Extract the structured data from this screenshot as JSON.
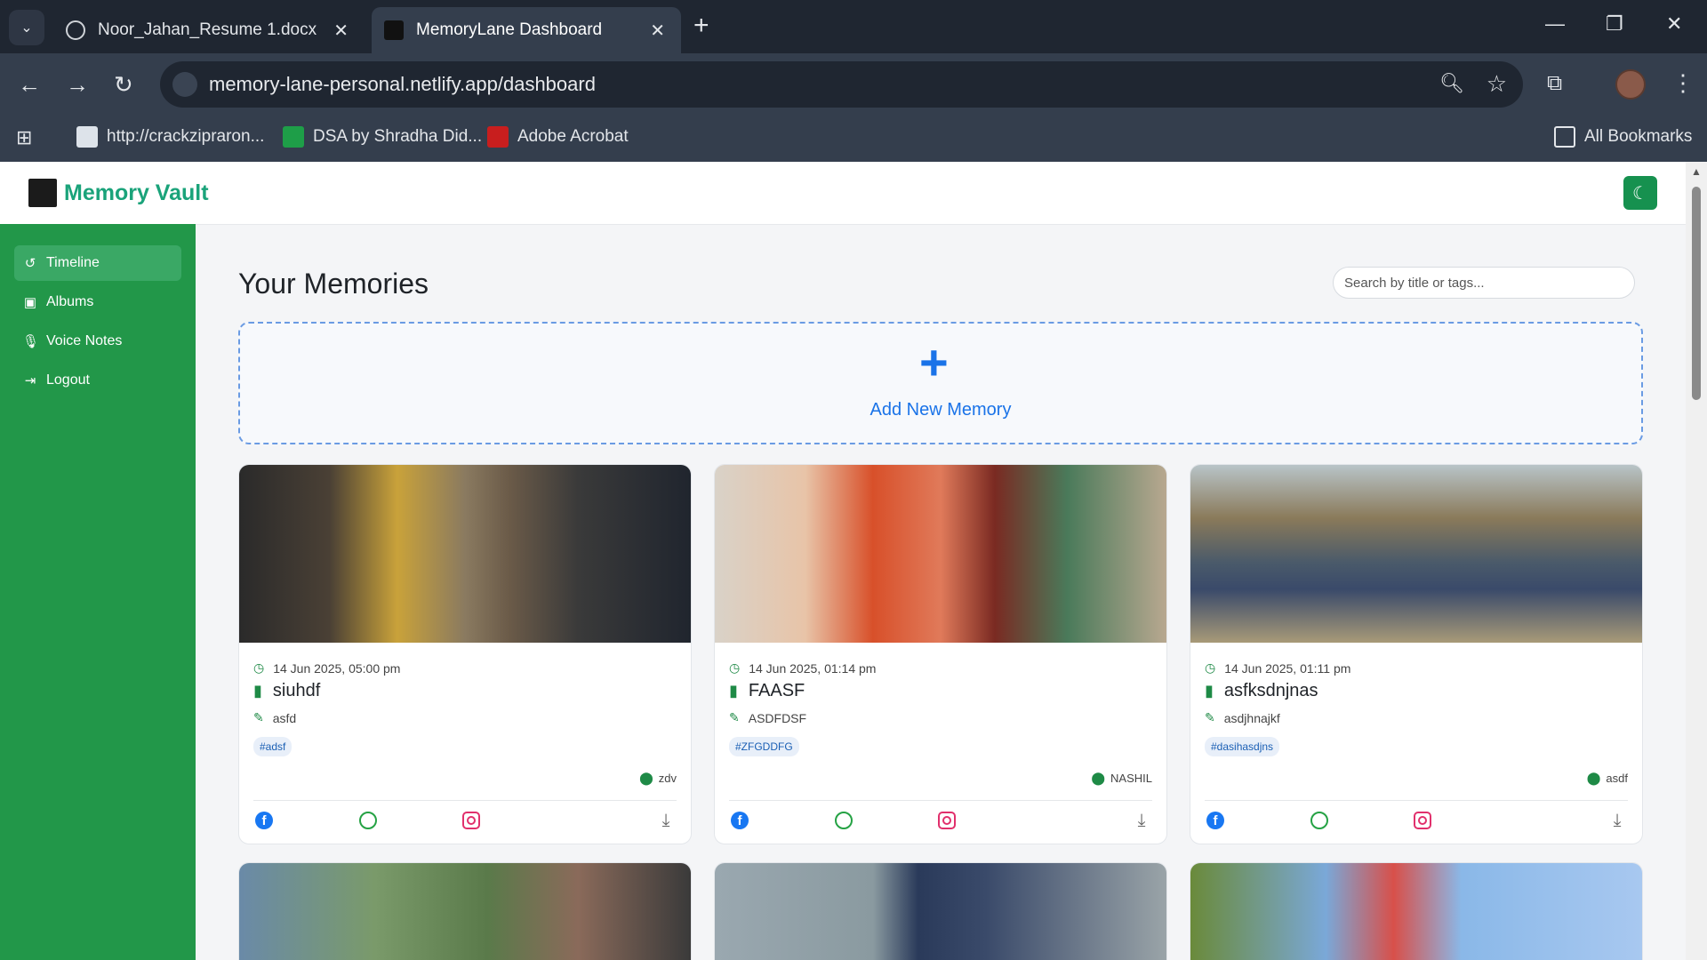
{
  "browser": {
    "tabs": [
      {
        "title": "Noor_Jahan_Resume 1.docx",
        "active": false
      },
      {
        "title": "MemoryLane Dashboard",
        "active": true
      }
    ],
    "url": "memory-lane-personal.netlify.app/dashboard",
    "bookmarks": [
      {
        "label": "http://crackzipraron..."
      },
      {
        "label": "DSA by Shradha Did..."
      },
      {
        "label": "Adobe Acrobat"
      }
    ],
    "all_bookmarks": "All Bookmarks"
  },
  "app": {
    "brand": "Memory Vault",
    "sidebar": [
      {
        "label": "Timeline",
        "icon": "history-icon",
        "active": true
      },
      {
        "label": "Albums",
        "icon": "image-icon",
        "active": false
      },
      {
        "label": "Voice Notes",
        "icon": "microphone-icon",
        "active": false
      },
      {
        "label": "Logout",
        "icon": "logout-icon",
        "active": false
      }
    ],
    "page_title": "Your Memories",
    "search_placeholder": "Search by title or tags...",
    "add_label": "Add New Memory",
    "cards": [
      {
        "date": "14 Jun 2025, 05:00 pm",
        "title": "siuhdf",
        "description": "asfd",
        "tag": "#adsf",
        "location": "zdv"
      },
      {
        "date": "14 Jun 2025, 01:14 pm",
        "title": "FAASF",
        "description": "ASDFDSF",
        "tag": "#ZFGDDFG",
        "location": "NASHIL"
      },
      {
        "date": "14 Jun 2025, 01:11 pm",
        "title": "asfksdnjnas",
        "description": "asdjhnajkf",
        "tag": "#dasihasdjns",
        "location": "asdf"
      }
    ]
  },
  "colors": {
    "sidebar": "#229749",
    "brand": "#1aa37a",
    "accent": "#1a73e8"
  }
}
